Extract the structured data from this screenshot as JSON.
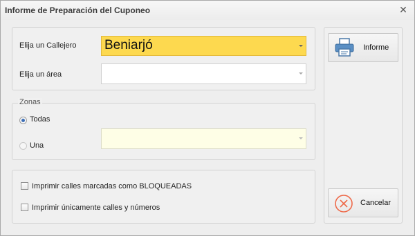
{
  "window": {
    "title": "Informe de Preparación del Cuponeo",
    "close_glyph": "✕"
  },
  "callejero": {
    "label": "Elija un Callejero",
    "value": "Beniarjó",
    "highlight_color": "#fdd94f"
  },
  "area": {
    "label": "Elija un área",
    "value": ""
  },
  "zonas": {
    "legend": "Zonas",
    "todas_label": "Todas",
    "todas_checked": true,
    "una_label": "Una",
    "una_checked": false,
    "una_combo_value": "",
    "una_combo_color": "#fefee6"
  },
  "options": {
    "bloqueadas_label": "Imprimir calles marcadas como BLOQUEADAS",
    "bloqueadas_checked": false,
    "numeros_label": "Imprimir únicamente calles y números",
    "numeros_checked": false
  },
  "buttons": {
    "informe_label": "Informe",
    "cancelar_label": "Cancelar"
  },
  "icons": {
    "informe": "printer-icon",
    "cancelar": "cancel-circle-x-icon"
  }
}
